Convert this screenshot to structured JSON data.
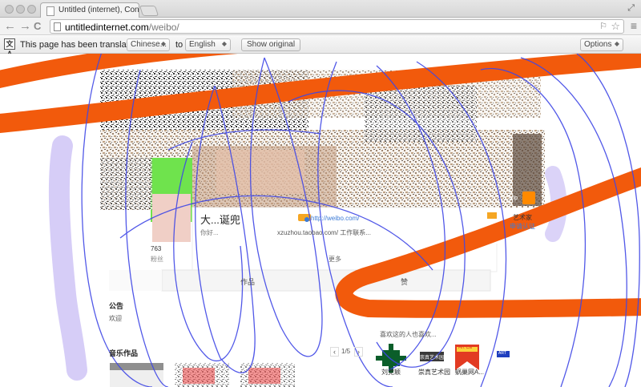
{
  "browser": {
    "tab_title": "Untitled (internet), Consta",
    "url_domain": "untitledinternet.com",
    "url_path": "/weibo/",
    "fullscreen_glyph": "⤢",
    "back_glyph": "←",
    "forward_glyph": "→",
    "reload_glyph": "C",
    "star_glyph": "☆",
    "menu_glyph": "≡"
  },
  "translate_bar": {
    "icon_glyph": "文A",
    "message": "This page has been translated from",
    "from_language": "Chinese...",
    "to_label": "to",
    "to_language": "English",
    "show_original": "Show original",
    "options": "Options"
  },
  "weibo": {
    "name": "大...诞兜",
    "vip_badge": "Vip",
    "profile_link": "http://weibo.com/",
    "bio_prefix": "你好...",
    "shop_link": "xzuzhou.taobao.com/ 工作联系...",
    "more_link": "更多",
    "count": "763",
    "count_label": "粉丝",
    "vip_tag": "Vip",
    "right_link": "艺术家",
    "right_sub": "申请认证",
    "tab_works": "作品",
    "tab_praise": "赞",
    "sidebar_heading": "公告",
    "sidebar_text": "欢迎",
    "music_heading": "音乐作品",
    "pager_prev": "‹",
    "pager": "1/5",
    "pager_next": "›",
    "recommend_heading": "喜欢这的人也喜欢...",
    "recommend": [
      {
        "name": "刘竞颖"
      },
      {
        "name": "崇真艺术园"
      },
      {
        "name": "蜗巢网A..."
      },
      {
        "name": ""
      }
    ],
    "recommend_logos": [
      "+",
      "崇真艺术园",
      "Art Ca",
      "ART"
    ]
  },
  "colors": {
    "orange_brush": "#f25a0c",
    "blue_scribble": "#3f47e6",
    "lavender_brush": "#d2c8f6"
  }
}
